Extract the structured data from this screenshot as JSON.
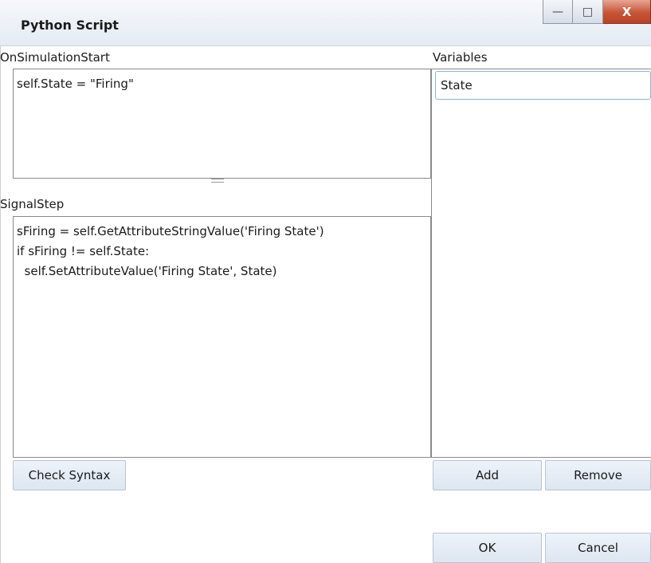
{
  "window": {
    "title": "Python Script",
    "minimize_icon": "minimize-icon",
    "maximize_icon": "maximize-icon",
    "close_icon": "close-icon",
    "close_glyph": "X"
  },
  "on_simulation_start": {
    "label": "OnSimulationStart",
    "code": "self.State = \"Firing\""
  },
  "signal_step": {
    "label": "SignalStep",
    "code": "sFiring = self.GetAttributeStringValue('Firing State')\nif sFiring != self.State:\n  self.SetAttributeValue('Firing State', State)"
  },
  "variables": {
    "label": "Variables",
    "items": [
      "State"
    ]
  },
  "buttons": {
    "check_syntax": "Check Syntax",
    "add": "Add",
    "remove": "Remove",
    "ok": "OK",
    "cancel": "Cancel"
  }
}
